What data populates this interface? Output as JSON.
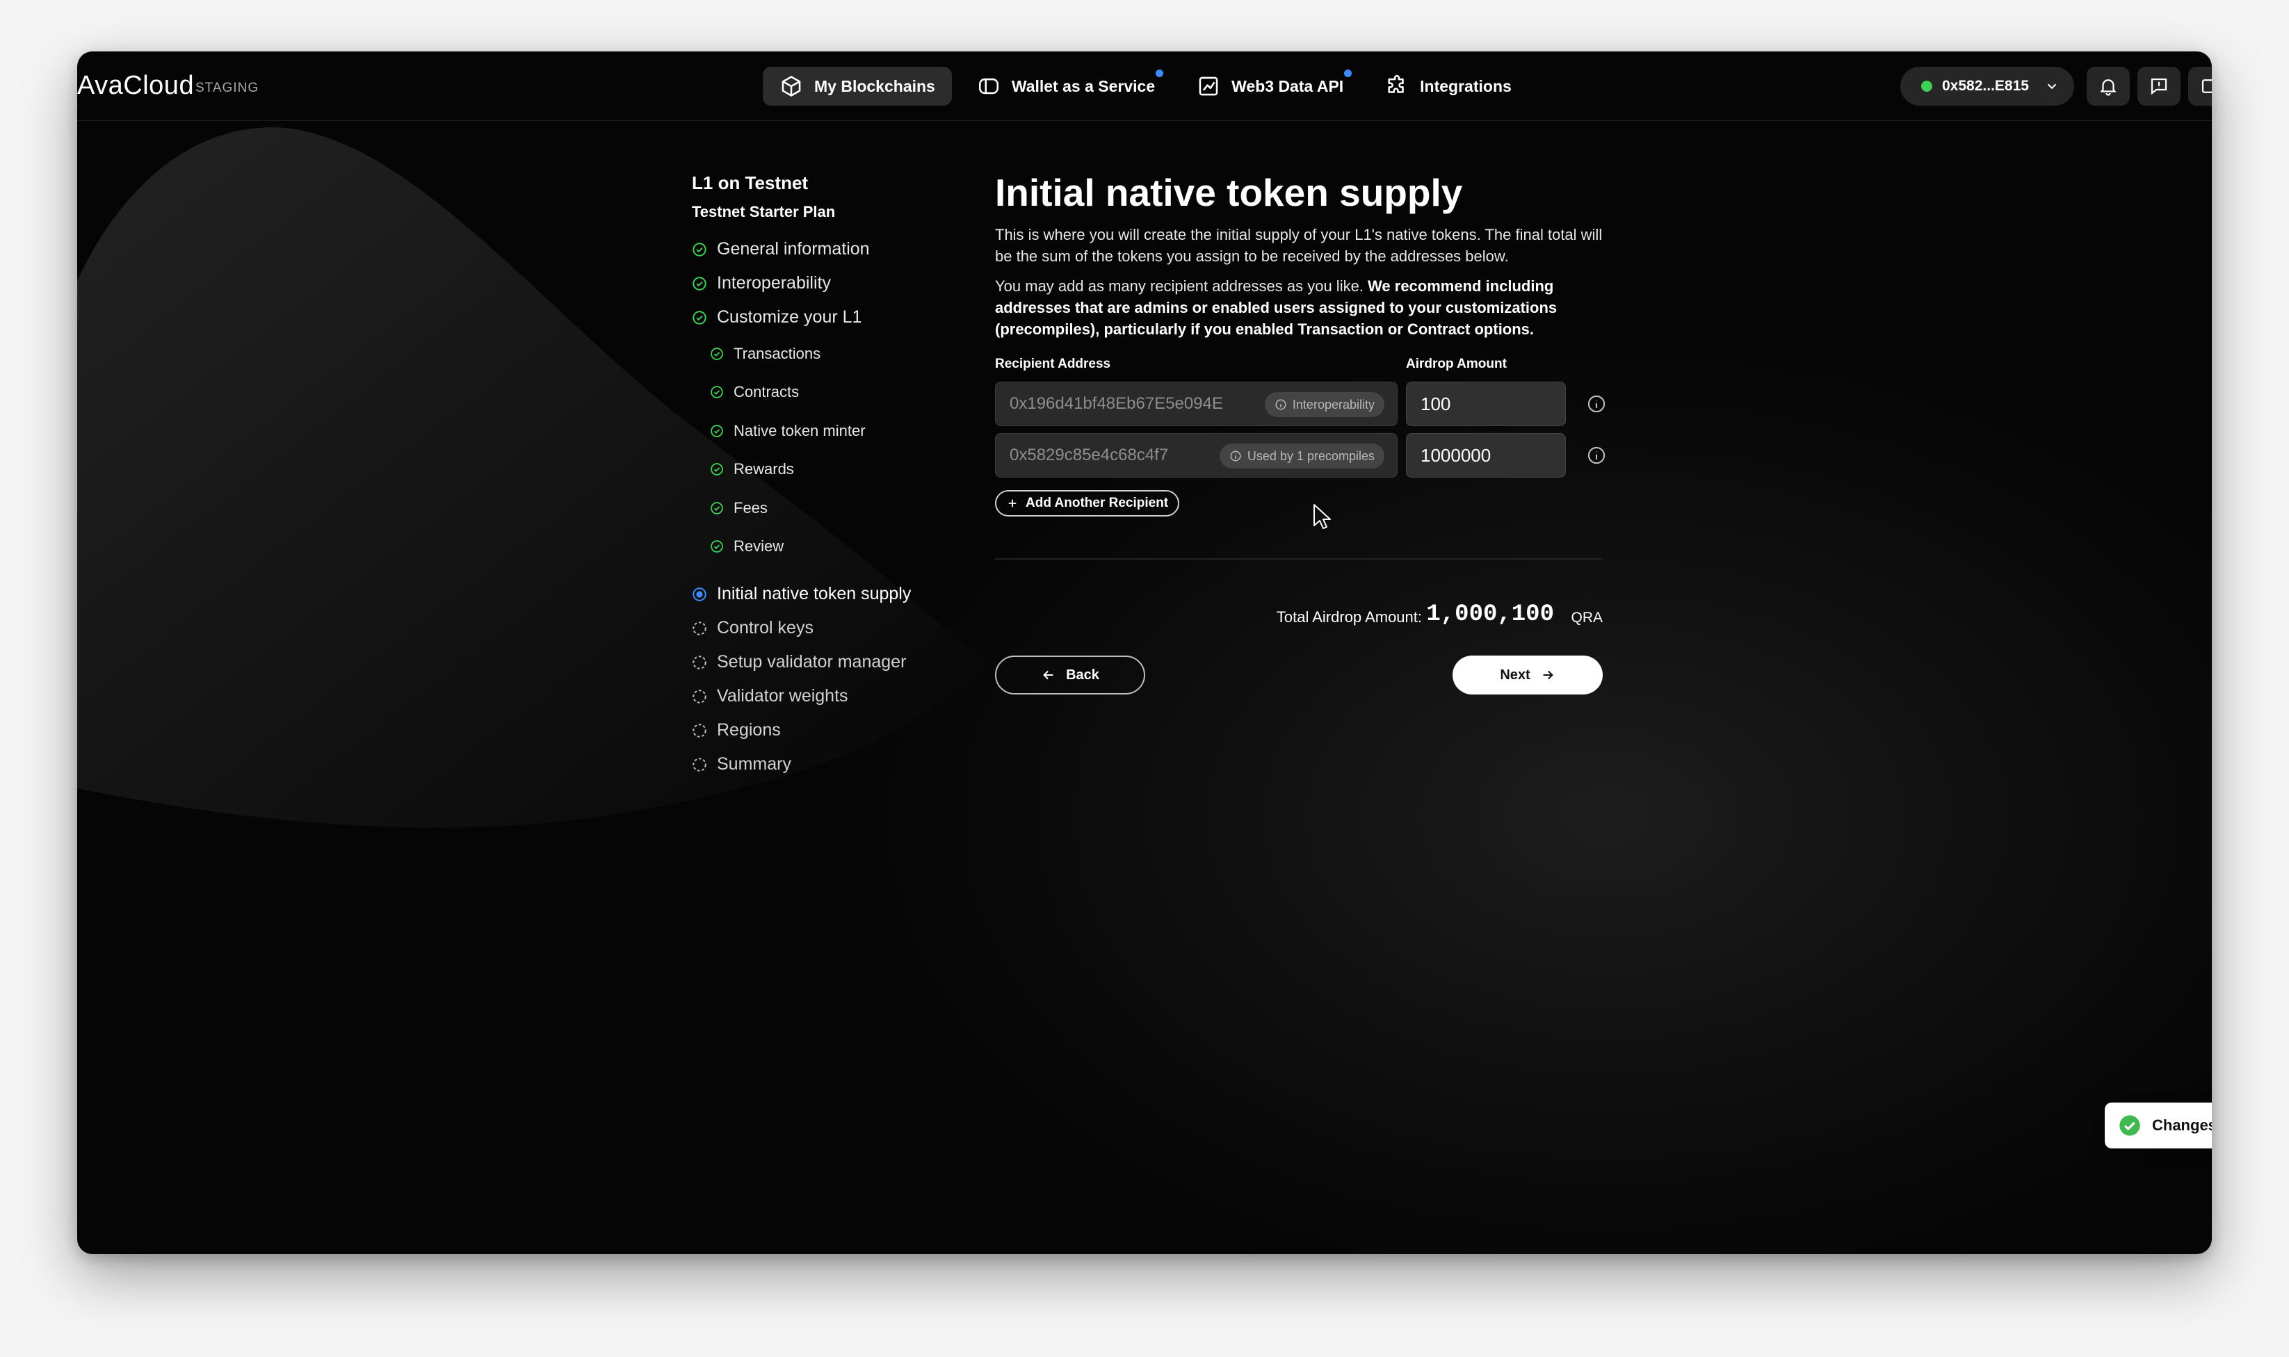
{
  "app": {
    "brand": "AvaCloud",
    "environment": "STAGING"
  },
  "nav": {
    "items": [
      {
        "label": "My Blockchains",
        "icon": "cube-icon",
        "active": true,
        "badge": false
      },
      {
        "label": "Wallet as a Service",
        "icon": "wallet-icon",
        "active": false,
        "badge": true
      },
      {
        "label": "Web3 Data API",
        "icon": "chart-icon",
        "active": false,
        "badge": true
      },
      {
        "label": "Integrations",
        "icon": "puzzle-icon",
        "active": false,
        "badge": false
      }
    ],
    "wallet_label": "0x582...E815",
    "wallet_status_color": "#3fcf55"
  },
  "sidebar": {
    "title": "L1 on Testnet",
    "subtitle": "Testnet Starter Plan",
    "steps": [
      {
        "label": "General information",
        "status": "done"
      },
      {
        "label": "Interoperability",
        "status": "done"
      },
      {
        "label": "Customize your L1",
        "status": "done"
      },
      {
        "label": "Transactions",
        "status": "done",
        "sub": true
      },
      {
        "label": "Contracts",
        "status": "done",
        "sub": true
      },
      {
        "label": "Native token minter",
        "status": "done",
        "sub": true
      },
      {
        "label": "Rewards",
        "status": "done",
        "sub": true
      },
      {
        "label": "Fees",
        "status": "done",
        "sub": true
      },
      {
        "label": "Review",
        "status": "done",
        "sub": true
      },
      {
        "label": "Initial native token supply",
        "status": "active"
      },
      {
        "label": "Control keys",
        "status": "pending"
      },
      {
        "label": "Setup validator manager",
        "status": "pending"
      },
      {
        "label": "Validator weights",
        "status": "pending"
      },
      {
        "label": "Regions",
        "status": "pending"
      },
      {
        "label": "Summary",
        "status": "pending"
      }
    ]
  },
  "main": {
    "title": "Initial native token supply",
    "intro": "This is where you will create the initial supply of your L1's native tokens. The final total will be the sum of the tokens you assign to be received by the addresses below.",
    "note_plain": "You may add as many recipient addresses as you like. ",
    "note_bold": "We recommend including addresses that are admins or enabled users assigned to your customizations (precompiles), particularly if you enabled Transaction or Contract options.",
    "recipient_label": "Recipient Address",
    "amount_label": "Airdrop Amount",
    "recipients": [
      {
        "address": "0x196d41bf48Eb67E5e094E",
        "tag": "Interoperability",
        "amount": "100"
      },
      {
        "address": "0x5829c85e4c68c4f7",
        "tag": "Used by 1 precompiles",
        "amount": "1000000"
      }
    ],
    "add_recipient_label": "Add Another Recipient",
    "total_label": "Total Airdrop Amount:",
    "total_value": "1,000,100",
    "total_unit": "QRA",
    "back_label": "Back",
    "next_label": "Next"
  },
  "toast": {
    "label": "Changes"
  },
  "colors": {
    "accent_blue": "#3d8bff",
    "done_green": "#3fcf55",
    "background": "#050505"
  }
}
